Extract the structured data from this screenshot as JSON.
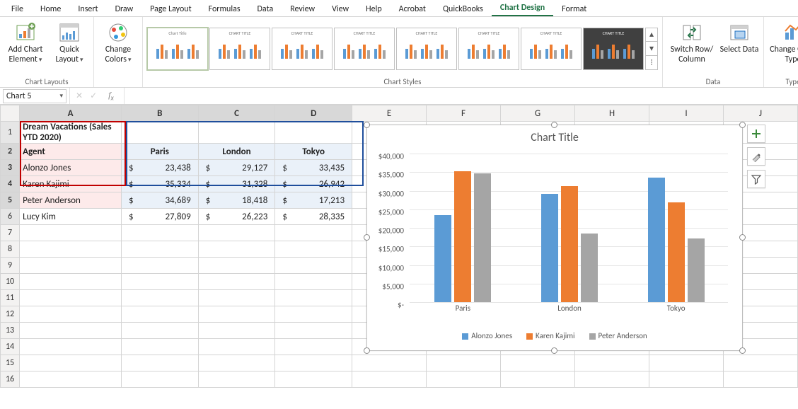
{
  "tabs": [
    "File",
    "Home",
    "Insert",
    "Draw",
    "Page Layout",
    "Formulas",
    "Data",
    "Review",
    "View",
    "Help",
    "Acrobat",
    "QuickBooks",
    "Chart Design",
    "Format"
  ],
  "active_tab": "Chart Design",
  "ribbon": {
    "addChart": "Add Chart Element",
    "quickLayout": "Quick Layout",
    "changeColors": "Change Colors",
    "switchRowCol": "Switch Row/ Column",
    "selectData": "Select Data",
    "changeType": "Change Chart Type",
    "groups": {
      "layouts": "Chart Layouts",
      "styles": "Chart Styles",
      "data": "Data",
      "type": "Type"
    }
  },
  "namebox": "Chart 5",
  "formula": "",
  "columns": [
    "A",
    "B",
    "C",
    "D",
    "E",
    "F",
    "G",
    "H",
    "I",
    "J"
  ],
  "rows_shown": 16,
  "table": {
    "title": "Dream Vacations (Sales YTD 2020)",
    "agent_header": "Agent",
    "city_headers": [
      "Paris",
      "London",
      "Tokyo"
    ],
    "rows": [
      {
        "agent": "Alonzo Jones",
        "vals": [
          23438,
          29127,
          33435
        ]
      },
      {
        "agent": "Karen Kajimi",
        "vals": [
          35334,
          31328,
          26942
        ]
      },
      {
        "agent": "Peter Anderson",
        "vals": [
          34689,
          18418,
          17213
        ]
      },
      {
        "agent": "Lucy Kim",
        "vals": [
          27809,
          26223,
          28335
        ]
      }
    ]
  },
  "chart_data": {
    "type": "bar",
    "title": "Chart Title",
    "categories": [
      "Paris",
      "London",
      "Tokyo"
    ],
    "series": [
      {
        "name": "Alonzo Jones",
        "values": [
          23438,
          29127,
          33435
        ]
      },
      {
        "name": "Karen Kajimi",
        "values": [
          35334,
          31328,
          26942
        ]
      },
      {
        "name": "Peter Anderson",
        "values": [
          34689,
          18418,
          17213
        ]
      }
    ],
    "ylim": [
      0,
      40000
    ],
    "ytick": 5000,
    "ylabel": "",
    "xlabel": ""
  },
  "colors": {
    "s0": "#5b9bd5",
    "s1": "#ed7d31",
    "s2": "#a5a5a5"
  },
  "side_buttons": [
    "chart-elements",
    "chart-styles",
    "chart-filters"
  ]
}
